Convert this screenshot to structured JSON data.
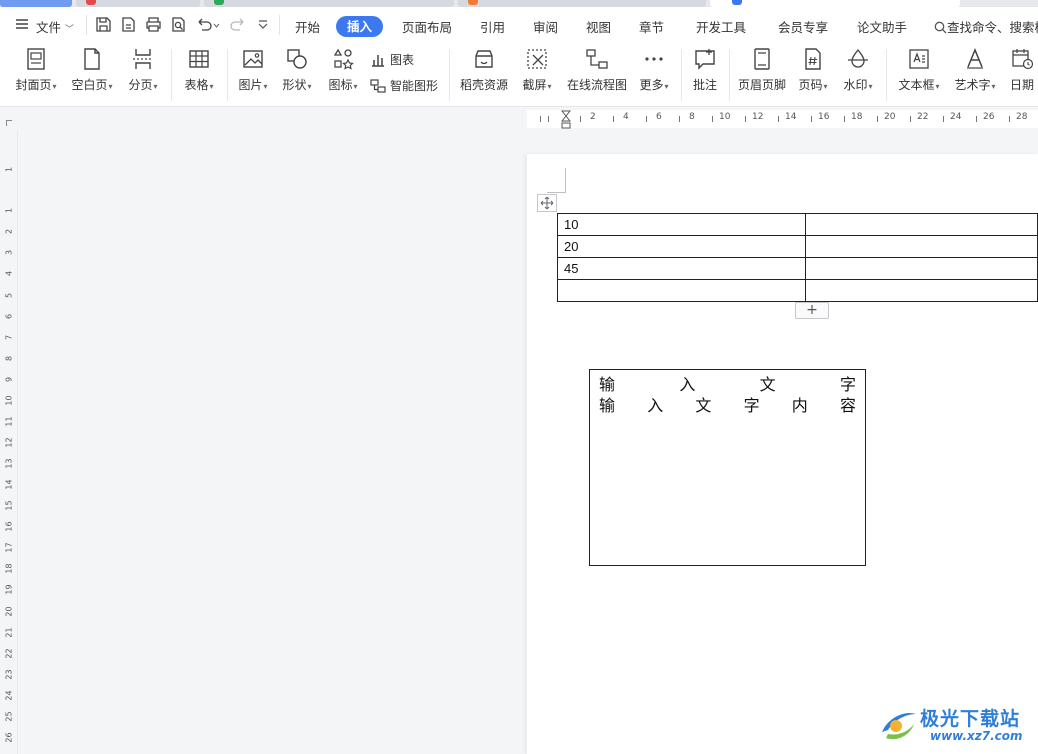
{
  "colors": {
    "accent": "#3c78f0",
    "logo": "#2f7fd8"
  },
  "menubar": {
    "file_label": "文件",
    "tabs": [
      {
        "label": "开始",
        "active": false
      },
      {
        "label": "插入",
        "active": true
      },
      {
        "label": "页面布局",
        "active": false
      },
      {
        "label": "引用",
        "active": false
      },
      {
        "label": "审阅",
        "active": false
      },
      {
        "label": "视图",
        "active": false
      },
      {
        "label": "章节",
        "active": false
      },
      {
        "label": "开发工具",
        "active": false
      },
      {
        "label": "会员专享",
        "active": false
      },
      {
        "label": "论文助手",
        "active": false
      }
    ],
    "search_label": "查找命令、搜索模"
  },
  "ribbon": {
    "cover": "封面页",
    "blank": "空白页",
    "pagebreak": "分页",
    "table": "表格",
    "picture": "图片",
    "shape": "形状",
    "icon": "图标",
    "chart": "图表",
    "smartart": "智能图形",
    "resources": "稻壳资源",
    "screenshot": "截屏",
    "flowchart": "在线流程图",
    "more": "更多",
    "comment": "批注",
    "header_footer": "页眉页脚",
    "page_number": "页码",
    "watermark": "水印",
    "textbox": "文本框",
    "wordart": "艺术字",
    "date": "日期"
  },
  "ruler": {
    "h_labels": [
      "2",
      "4",
      "6",
      "8",
      "10",
      "12",
      "14",
      "16",
      "18",
      "20",
      "22",
      "24",
      "26",
      "28"
    ],
    "v_labels": [
      "1",
      "2",
      "3",
      "4",
      "5",
      "6",
      "7",
      "8",
      "9",
      "10",
      "11",
      "12",
      "13",
      "14",
      "15",
      "16",
      "17",
      "18",
      "19",
      "20",
      "21",
      "22",
      "23",
      "24",
      "25",
      "26"
    ],
    "v_top_label": "1"
  },
  "document": {
    "table_rows": [
      [
        "10",
        ""
      ],
      [
        "20",
        ""
      ],
      [
        "45",
        ""
      ],
      [
        "",
        ""
      ]
    ],
    "add_row_symbol": "+",
    "textbox_lines": [
      [
        "输",
        "入",
        "文",
        "字"
      ],
      [
        "输",
        "入",
        "文",
        "字",
        "内",
        "容"
      ]
    ]
  },
  "watermark": {
    "title": "极光下载站",
    "url": "www.xz7.com"
  }
}
